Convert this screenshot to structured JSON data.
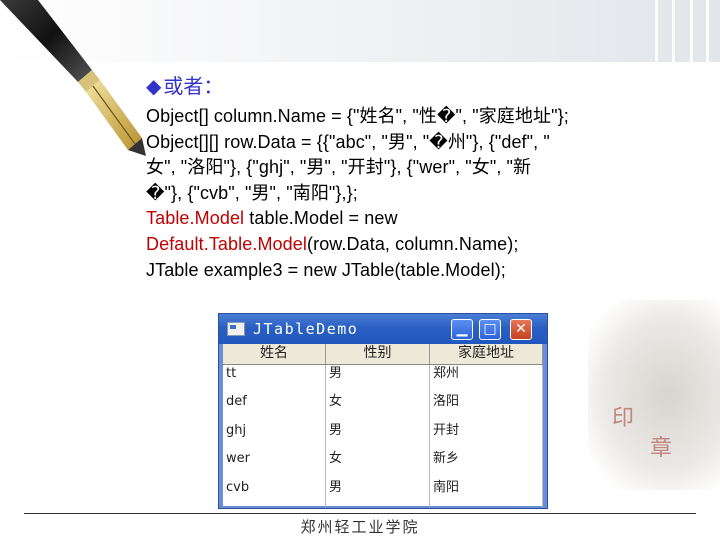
{
  "heading": {
    "bullet": "◆",
    "text": "或者："
  },
  "code_lines": [
    {
      "text": "Object[] column.Name = {\"姓名\", \"性\u0000\", \"家庭地址\"};"
    },
    {
      "text": "Object[][] row.Data = {{\"abc\", \"男\", \"\u0000州\"}, {\"def\", \""
    },
    {
      "text": "女\", \"洛阳\"},  {\"ghj\", \"男\", \"开封\"}, {\"wer\", \"女\", \"新"
    },
    {
      "text": "\u0000\"}, {\"cvb\", \"男\", \"南阳\"},};"
    },
    {
      "prefix": "Table.Model",
      "rest": " table.Model = new"
    },
    {
      "prefix": "Default.Table.Model",
      "rest": "(row.Data, column.Name);"
    },
    {
      "text": "JTable example3 = new JTable(table.Model);"
    }
  ],
  "window": {
    "title": "JTableDemo",
    "buttons": {
      "minimize": "▁",
      "maximize": "□",
      "close": "✕"
    },
    "columns": [
      "姓名",
      "性别",
      "家庭地址"
    ],
    "rows": [
      [
        "tt",
        "男",
        "郑州"
      ],
      [
        "def",
        "女",
        "洛阳"
      ],
      [
        "ghj",
        "男",
        "开封"
      ],
      [
        "wer",
        "女",
        "新乡"
      ],
      [
        "cvb",
        "男",
        "南阳"
      ]
    ]
  },
  "footer": {
    "text": "郑州轻工业学院"
  },
  "colors": {
    "heading": "#3333cc",
    "highlight": "#c00000",
    "titlebar": "#2257bd"
  }
}
